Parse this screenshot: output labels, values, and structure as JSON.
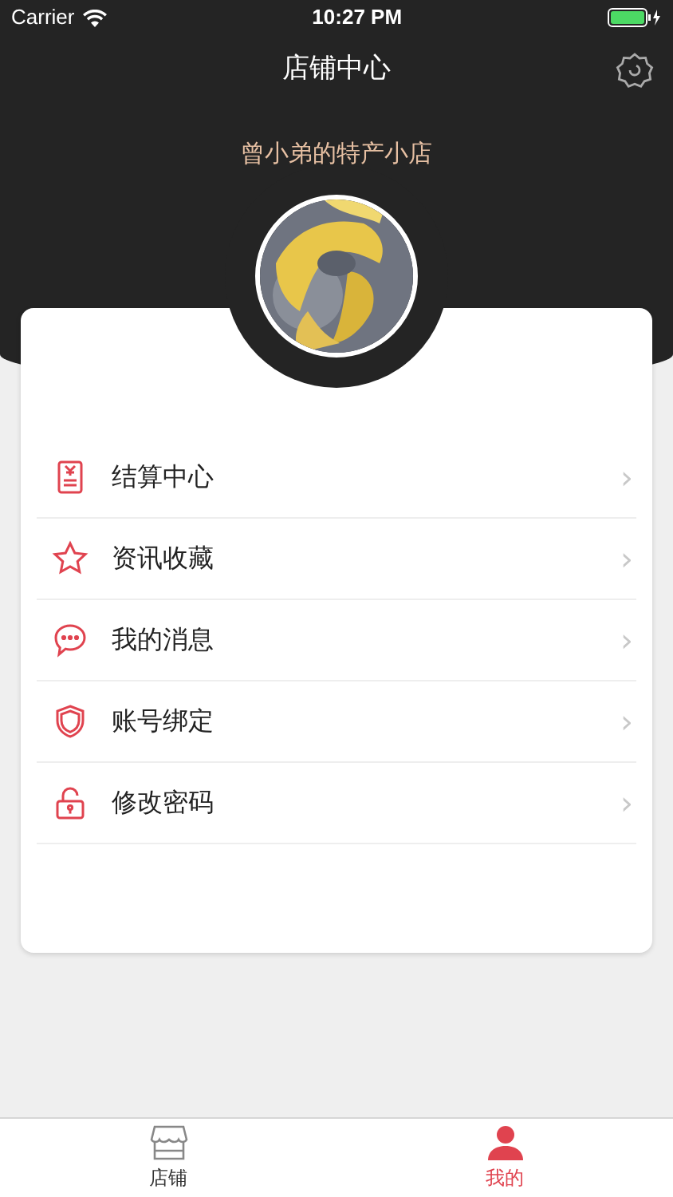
{
  "status_bar": {
    "carrier": "Carrier",
    "time": "10:27 PM"
  },
  "nav": {
    "title": "店铺中心"
  },
  "shop": {
    "name": "曾小弟的特产小店"
  },
  "menu": [
    {
      "kind": "bill",
      "label": "结算中心",
      "chevron": "›"
    },
    {
      "kind": "star",
      "label": "资讯收藏",
      "chevron": "›"
    },
    {
      "kind": "chat",
      "label": "我的消息",
      "chevron": "›"
    },
    {
      "kind": "shield",
      "label": "账号绑定",
      "chevron": "›"
    },
    {
      "kind": "lock",
      "label": "修改密码",
      "chevron": "›"
    }
  ],
  "tab_bar": [
    {
      "kind": "store",
      "label": "店铺",
      "selected": false
    },
    {
      "kind": "person",
      "label": "我的",
      "selected": true
    }
  ]
}
